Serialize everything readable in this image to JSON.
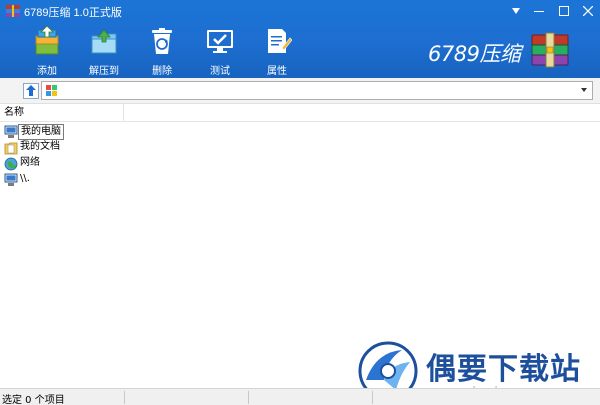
{
  "window": {
    "title": "6789压缩 1.0正式版"
  },
  "toolbar": {
    "items": [
      {
        "label": "添加",
        "icon": "add-archive-icon"
      },
      {
        "label": "解压到",
        "icon": "extract-icon"
      },
      {
        "label": "删除",
        "icon": "recycle-bin-icon"
      },
      {
        "label": "测试",
        "icon": "test-monitor-icon"
      },
      {
        "label": "属性",
        "icon": "properties-icon"
      }
    ]
  },
  "brand": {
    "text": "6789压缩"
  },
  "addressbar": {
    "value": ""
  },
  "columns": {
    "name": "名称"
  },
  "files": [
    {
      "name": "我的电脑",
      "icon": "computer-icon"
    },
    {
      "name": "我的文档",
      "icon": "documents-icon"
    },
    {
      "name": "网络",
      "icon": "network-icon"
    },
    {
      "name": "\\\\.",
      "icon": "computer-icon"
    }
  ],
  "status": {
    "text": "选定 0 个项目"
  },
  "watermark": {
    "title": "偶要下载站",
    "url": "ouyaoxiazai.com"
  },
  "colors": {
    "toolbar_blue": "#1d6ed0",
    "watermark_blue": "#1d4f9c"
  }
}
